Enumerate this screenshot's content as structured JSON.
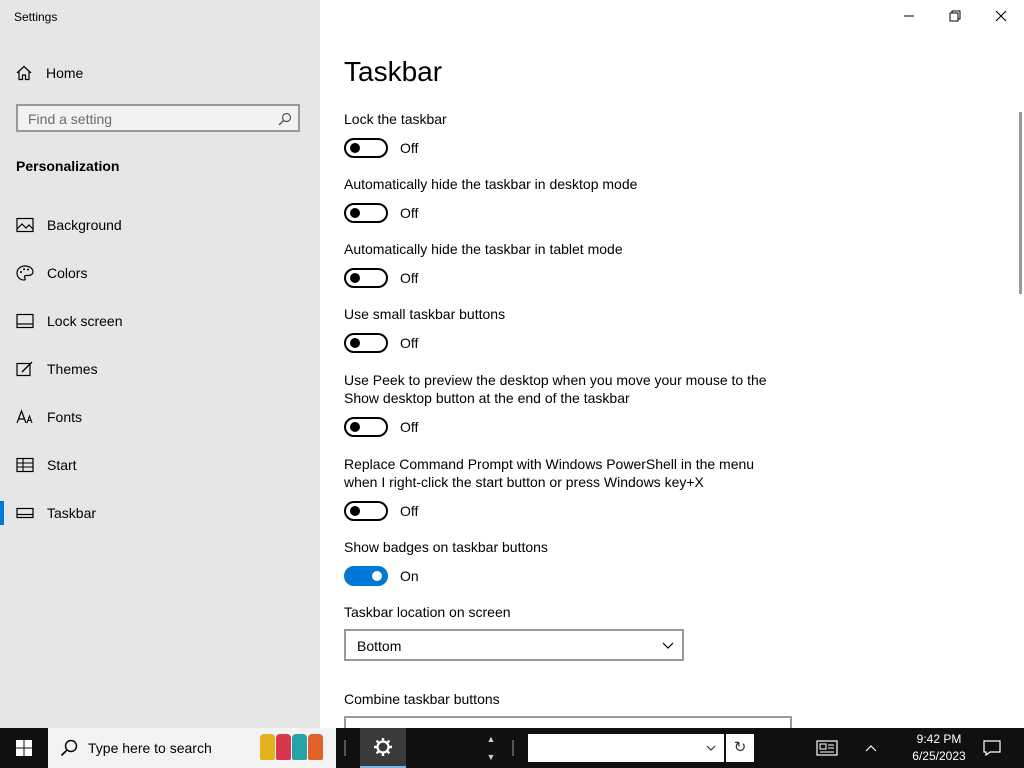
{
  "window": {
    "app_title": "Settings"
  },
  "sidebar": {
    "home_label": "Home",
    "search_placeholder": "Find a setting",
    "section_title": "Personalization",
    "items": [
      {
        "label": "Background",
        "icon": "picture-icon"
      },
      {
        "label": "Colors",
        "icon": "palette-icon"
      },
      {
        "label": "Lock screen",
        "icon": "lock-screen-icon"
      },
      {
        "label": "Themes",
        "icon": "themes-icon"
      },
      {
        "label": "Fonts",
        "icon": "fonts-icon"
      },
      {
        "label": "Start",
        "icon": "start-icon"
      },
      {
        "label": "Taskbar",
        "icon": "taskbar-icon",
        "active": true
      }
    ]
  },
  "main": {
    "title": "Taskbar",
    "settings": [
      {
        "label": "Lock the taskbar",
        "state": "Off"
      },
      {
        "label": "Automatically hide the taskbar in desktop mode",
        "state": "Off"
      },
      {
        "label": "Automatically hide the taskbar in tablet mode",
        "state": "Off"
      },
      {
        "label": "Use small taskbar buttons",
        "state": "Off"
      },
      {
        "label": "Use Peek to preview the desktop when you move your mouse to the Show desktop button at the end of the taskbar",
        "state": "Off"
      },
      {
        "label": "Replace Command Prompt with Windows PowerShell in the menu when I right-click the start button or press Windows key+X",
        "state": "Off"
      },
      {
        "label": "Show badges on taskbar buttons",
        "state": "On"
      }
    ],
    "location_label": "Taskbar location on screen",
    "location_value": "Bottom",
    "combine_label": "Combine taskbar buttons"
  },
  "taskbar": {
    "search_placeholder": "Type here to search",
    "time": "9:42 PM",
    "date": "6/25/2023"
  },
  "colors": {
    "accent": "#0078d7",
    "sidebar_bg": "#e6e6e6",
    "taskbar_bg": "#101010"
  }
}
